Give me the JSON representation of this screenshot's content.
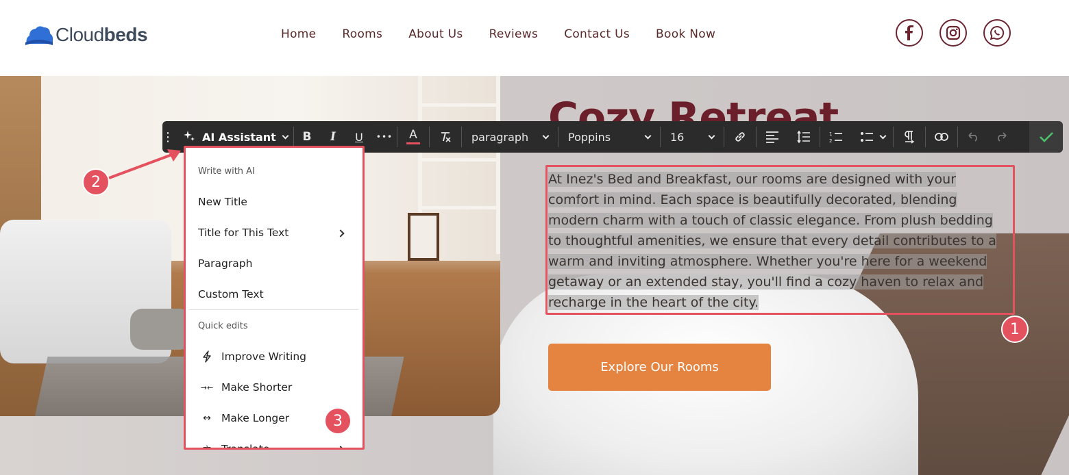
{
  "brand": {
    "logo_text_light": "Cloud",
    "logo_text_bold": "beds"
  },
  "nav": {
    "items": [
      "Home",
      "Rooms",
      "About Us",
      "Reviews",
      "Contact Us",
      "Book Now"
    ]
  },
  "social": [
    {
      "icon": "facebook-icon"
    },
    {
      "icon": "instagram-icon"
    },
    {
      "icon": "whatsapp-icon"
    }
  ],
  "hero": {
    "title": "Cozy Retreat",
    "paragraph": "At Inez's Bed and Breakfast, our rooms are designed with your comfort in mind. Each space is beautifully decorated, blending modern charm with a touch of classic elegance. From plush bedding to thoughtful amenities, we ensure that every detail contributes to a warm and inviting atmosphere. Whether you're here for a weekend getaway or an extended stay, you'll find a cozy haven to relax and recharge in the heart of the city.",
    "cta_label": "Explore Our Rooms"
  },
  "toolbar": {
    "ai_label": "AI Assistant",
    "block_type": "paragraph",
    "font_family": "Poppins",
    "font_size": "16",
    "bold": "B",
    "italic": "I",
    "underline": "U",
    "more": "•••",
    "text_color_glyph": "A"
  },
  "ai_menu": {
    "section_write": "Write with AI",
    "write_items": [
      "New Title",
      "Title for This Text",
      "Paragraph",
      "Custom Text"
    ],
    "section_quick": "Quick edits",
    "quick_items": [
      "Improve Writing",
      "Make Shorter",
      "Make Longer",
      "Translate"
    ]
  },
  "callouts": {
    "one": "1",
    "two": "2",
    "three": "3"
  },
  "colors": {
    "brand_maroon": "#6b1f2a",
    "cta_orange": "#e58440",
    "highlight_red": "#e4525f",
    "toolbar_bg": "#2b2b2b",
    "confirm_green": "#4cc06a"
  }
}
